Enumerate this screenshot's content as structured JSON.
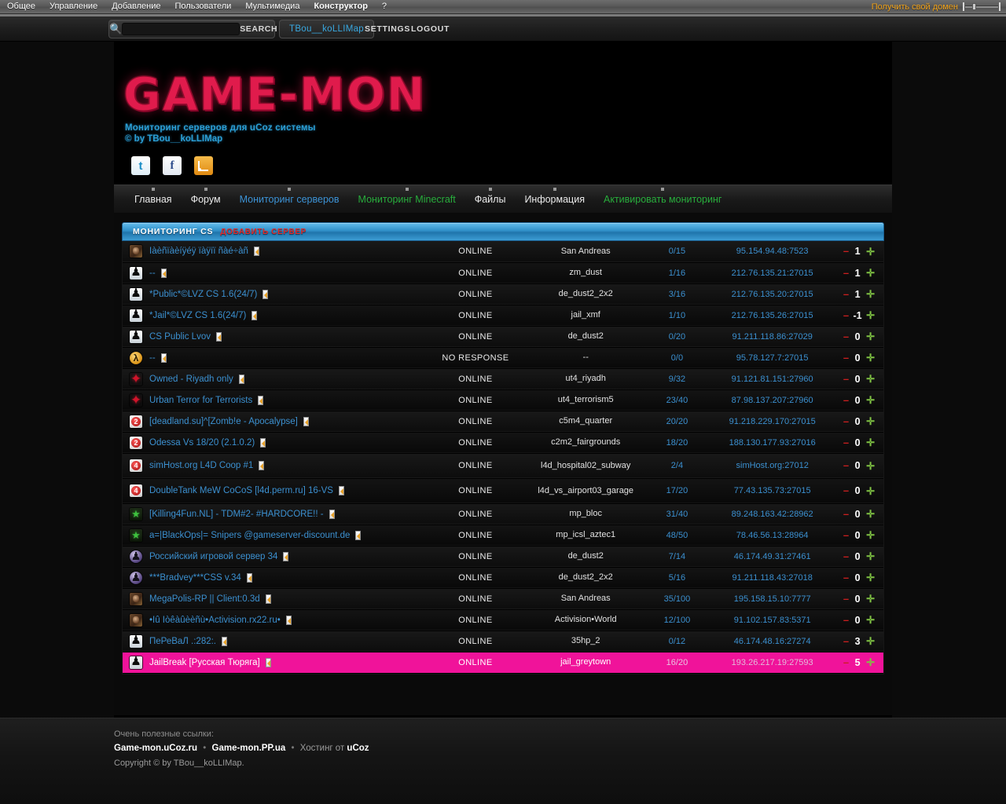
{
  "ucoz_bar": {
    "menu": [
      {
        "label": "Общее",
        "bold": false
      },
      {
        "label": "Управление",
        "bold": false
      },
      {
        "label": "Добавление",
        "bold": false
      },
      {
        "label": "Пользователи",
        "bold": false
      },
      {
        "label": "Мультимедиа",
        "bold": false
      },
      {
        "label": "Конструктор",
        "bold": true
      },
      {
        "label": "?",
        "bold": false
      }
    ],
    "domain_link": "Получить свой домен",
    "slider_icon": "slider-icon"
  },
  "topstrip": {
    "search_icon": "search-icon",
    "search_value": "",
    "search_placeholder": "",
    "search_label": "SEARCH",
    "username": "TBou__koLLIMap",
    "settings_label": "SETTINGS",
    "logout_label": "LOGOUT"
  },
  "header": {
    "logo": "GAME-MON",
    "tagline": "Мониторинг серверов для uCoz системы",
    "byline": "© by TBou__koLLIMap",
    "socials": [
      {
        "name": "twitter-icon",
        "glyph": "t"
      },
      {
        "name": "facebook-icon",
        "glyph": "f"
      },
      {
        "name": "rss-icon",
        "glyph": ""
      }
    ]
  },
  "nav": [
    {
      "label": "Главная",
      "color": "white",
      "pin": true
    },
    {
      "label": "Форум",
      "color": "white",
      "pin": true
    },
    {
      "label": "Мониторинг серверов",
      "color": "blue",
      "pin": true
    },
    {
      "label": "Мониторинг Minecraft",
      "color": "green",
      "pin": true
    },
    {
      "label": "Файлы",
      "color": "white",
      "pin": true
    },
    {
      "label": "Информация",
      "color": "white",
      "pin": true
    },
    {
      "label": "Активировать мониторинг",
      "color": "green",
      "pin": true
    }
  ],
  "section": {
    "title": "МОНИТОРИНГ CS",
    "add_server": "ДОБАВИТЬ СЕРВЕР"
  },
  "table": {
    "rows": [
      {
        "icon": "gi-samp",
        "icon_name": "samp-icon",
        "name": "Ïàèñïàèíÿéÿ ïàÿïï ñàé÷àñ",
        "status": "ONLINE",
        "map": "San Andreas",
        "players": "0/15",
        "ip": "95.154.94.48:7523",
        "rating": "1",
        "tall": false,
        "highlight": false
      },
      {
        "icon": "gi-cs",
        "icon_name": "counter-strike-icon",
        "name": "--",
        "status": "ONLINE",
        "map": "zm_dust",
        "players": "1/16",
        "ip": "212.76.135.21:27015",
        "rating": "1",
        "tall": false,
        "highlight": false
      },
      {
        "icon": "gi-cs",
        "icon_name": "counter-strike-icon",
        "name": "*Public*©LVZ CS 1.6(24/7)",
        "status": "ONLINE",
        "map": "de_dust2_2x2",
        "players": "3/16",
        "ip": "212.76.135.20:27015",
        "rating": "1",
        "tall": false,
        "highlight": false
      },
      {
        "icon": "gi-cs",
        "icon_name": "counter-strike-icon",
        "name": "*Jail*©LVZ CS 1.6(24/7)",
        "status": "ONLINE",
        "map": "jail_xmf",
        "players": "1/10",
        "ip": "212.76.135.26:27015",
        "rating": "-1",
        "tall": false,
        "highlight": false
      },
      {
        "icon": "gi-cs",
        "icon_name": "counter-strike-icon",
        "name": "CS Public Lvov",
        "status": "ONLINE",
        "map": "de_dust2",
        "players": "0/20",
        "ip": "91.211.118.86:27029",
        "rating": "0",
        "tall": false,
        "highlight": false
      },
      {
        "icon": "gi-hl",
        "icon_name": "half-life-icon",
        "name": "--",
        "status": "NO RESPONSE",
        "map": "--",
        "players": "0/0",
        "ip": "95.78.127.7:27015",
        "rating": "0",
        "tall": false,
        "highlight": false
      },
      {
        "icon": "gi-ut",
        "icon_name": "urban-terror-icon",
        "name": "Owned - Riyadh only",
        "status": "ONLINE",
        "map": "ut4_riyadh",
        "players": "9/32",
        "ip": "91.121.81.151:27960",
        "rating": "0",
        "tall": false,
        "highlight": false
      },
      {
        "icon": "gi-ut",
        "icon_name": "urban-terror-icon",
        "name": "Urban Terror for Terrorists",
        "status": "ONLINE",
        "map": "ut4_terrorism5",
        "players": "23/40",
        "ip": "87.98.137.207:27960",
        "rating": "0",
        "tall": false,
        "highlight": false
      },
      {
        "icon": "gi-l4d",
        "icon_name": "left4dead-icon",
        "name": "[deadland.su]^[Zomb!e - Apocalypse]",
        "status": "ONLINE",
        "map": "c5m4_quarter",
        "players": "20/20",
        "ip": "91.218.229.170:27015",
        "rating": "0",
        "tall": false,
        "highlight": false
      },
      {
        "icon": "gi-l4d",
        "icon_name": "left4dead-icon",
        "name": "Odessa Vs 18/20 (2.1.0.2)",
        "status": "ONLINE",
        "map": "c2m2_fairgrounds",
        "players": "18/20",
        "ip": "188.130.177.93:27016",
        "rating": "0",
        "tall": false,
        "highlight": false
      },
      {
        "icon": "gi-l4d2",
        "icon_name": "left4dead2-icon",
        "name": "simHost.org L4D Coop #1",
        "status": "ONLINE",
        "map": "l4d_hospital02_subway",
        "players": "2/4",
        "ip": "simHost.org:27012",
        "rating": "0",
        "tall": true,
        "highlight": false
      },
      {
        "icon": "gi-l4d2",
        "icon_name": "left4dead2-icon",
        "name": "DoubleTank MeW CoCoS [l4d.perm.ru] 16-VS",
        "status": "ONLINE",
        "map": "l4d_vs_airport03_garage",
        "players": "17/20",
        "ip": "77.43.135.73:27015",
        "rating": "0",
        "tall": true,
        "highlight": false
      },
      {
        "icon": "gi-cod",
        "icon_name": "call-of-duty-icon",
        "name": "[Killing4Fun.NL] - TDM#2- #HARDCORE!! -",
        "status": "ONLINE",
        "map": "mp_bloc",
        "players": "31/40",
        "ip": "89.248.163.42:28962",
        "rating": "0",
        "tall": false,
        "highlight": false
      },
      {
        "icon": "gi-cod",
        "icon_name": "call-of-duty-icon",
        "name": "a=|BlackOps|= Snipers @gameserver-discount.de",
        "status": "ONLINE",
        "map": "mp_icsl_aztec1",
        "players": "48/50",
        "ip": "78.46.56.13:28964",
        "rating": "0",
        "tall": false,
        "highlight": false
      },
      {
        "icon": "gi-css",
        "icon_name": "counter-strike-source-icon",
        "name": "Российский игровой сервер 34",
        "status": "ONLINE",
        "map": "de_dust2",
        "players": "7/14",
        "ip": "46.174.49.31:27461",
        "rating": "0",
        "tall": false,
        "highlight": false
      },
      {
        "icon": "gi-css",
        "icon_name": "counter-strike-source-icon",
        "name": "***Bradvey***CSS v.34",
        "status": "ONLINE",
        "map": "de_dust2_2x2",
        "players": "5/16",
        "ip": "91.211.118.43:27018",
        "rating": "0",
        "tall": false,
        "highlight": false
      },
      {
        "icon": "gi-samp",
        "icon_name": "samp-icon",
        "name": "MegaPolis-RP || Client:0.3d",
        "status": "ONLINE",
        "map": "San Andreas",
        "players": "35/100",
        "ip": "195.158.15.10:7777",
        "rating": "0",
        "tall": false,
        "highlight": false
      },
      {
        "icon": "gi-samp",
        "icon_name": "samp-icon",
        "name": "•Ìû Îòêàûèèñù•Activision.rx22.ru•",
        "status": "ONLINE",
        "map": "Activision•World",
        "players": "12/100",
        "ip": "91.102.157.83:5371",
        "rating": "0",
        "tall": false,
        "highlight": false
      },
      {
        "icon": "gi-cs",
        "icon_name": "counter-strike-icon",
        "name": "ПеРеВаЛ .:282:.",
        "status": "ONLINE",
        "map": "35hp_2",
        "players": "0/12",
        "ip": "46.174.48.16:27274",
        "rating": "3",
        "tall": false,
        "highlight": false
      },
      {
        "icon": "gi-cs",
        "icon_name": "counter-strike-icon",
        "name": "JailBreak [Русская Тюряга]",
        "status": "ONLINE",
        "map": "jail_greytown",
        "players": "16/20",
        "ip": "193.26.217.19:27593",
        "rating": "5",
        "tall": false,
        "highlight": true
      }
    ],
    "minus_label": "–",
    "plus_label": "✛"
  },
  "footer": {
    "useful": "Очень полезные ссылки:",
    "link1": "Game-mon.uCoz.ru",
    "link2": "Game-mon.PP.ua",
    "hosting_prefix": "Хостинг от ",
    "hosting_name": "uCoz",
    "copyright": "Copyright © by TBou__koLLIMap."
  },
  "colors": {
    "accent_blue": "#3b90d0",
    "logo_red": "#e01b4c",
    "highlight_pink": "#f0139a",
    "nav_green": "#28ad3c",
    "minus_red": "#cc1f1f",
    "plus_green": "#7fc143",
    "domain_orange": "#f0a21a"
  }
}
